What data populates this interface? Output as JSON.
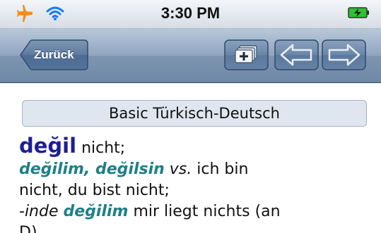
{
  "status_bar": {
    "time": "3:30 PM",
    "icons": [
      "airplane-icon",
      "wifi-icon",
      "battery-charging-icon"
    ],
    "airplane_color": "#f28c1a",
    "wifi_color": "#1a7cf2",
    "battery_color": "#2fc12f"
  },
  "nav_bar": {
    "back_label": "Zurück",
    "buttons": [
      "new-tab-icon",
      "back-arrow-icon",
      "forward-arrow-icon"
    ]
  },
  "content": {
    "dictionary_title": "Basic Türkisch-Deutsch",
    "entry": {
      "headword": "değil",
      "headword_translation": " nicht;",
      "phrase1": "değilim, değilsin",
      "phrase1_vs": " vs.",
      "phrase1_translation_a": " ich bin",
      "phrase1_translation_b": "nicht, du bist nicht;",
      "phrase2_prefix": "-inde",
      "phrase2": "değilim",
      "phrase2_translation": " mir liegt nichts (an",
      "phrase2_continuation": "D)"
    }
  }
}
